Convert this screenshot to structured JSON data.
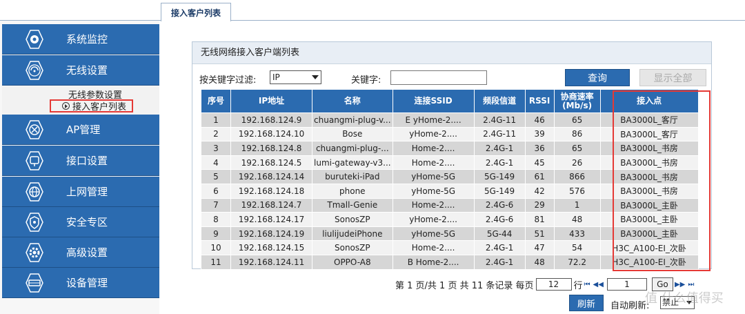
{
  "tab": {
    "label": "接入客户列表"
  },
  "sidebar": {
    "items": [
      {
        "label": "系统监控",
        "icon": "gear-monitor-icon"
      },
      {
        "label": "无线设置",
        "icon": "wifi-icon"
      },
      {
        "label": "AP管理",
        "icon": "ap-icon"
      },
      {
        "label": "接口设置",
        "icon": "port-icon"
      },
      {
        "label": "上网管理",
        "icon": "globe-icon"
      },
      {
        "label": "安全专区",
        "icon": "shield-icon"
      },
      {
        "label": "高级设置",
        "icon": "settings-icon"
      },
      {
        "label": "设备管理",
        "icon": "device-icon"
      }
    ],
    "submenu": {
      "item1": "无线参数设置",
      "item2": "接入客户列表"
    }
  },
  "panel": {
    "title": "无线网络接入客户端列表"
  },
  "filter": {
    "label": "按关键字过滤:",
    "selected": "IP",
    "keyword_label": "关键字:",
    "keyword_value": "",
    "query_button": "查询",
    "show_all_button": "显示全部"
  },
  "table": {
    "headers": [
      "序号",
      "IP地址",
      "名称",
      "连接SSID",
      "频段信道",
      "RSSI",
      "协商速率 (Mb/s)",
      "接入点"
    ],
    "rows": [
      [
        "1",
        "192.168.124.9",
        "chuangmi-plug-v...",
        "E    yHome-2....",
        "2.4G-11",
        "46",
        "65",
        "BA3000L_客厅"
      ],
      [
        "2",
        "192.168.124.10",
        "Bose",
        "    yHome-2....",
        "2.4G-11",
        "39",
        "86",
        "BA3000L_客厅"
      ],
      [
        "3",
        "192.168.124.8",
        "chuangmi-plug-...",
        "     Home-2....",
        "2.4G-1",
        "36",
        "65",
        "BA3000L_书房"
      ],
      [
        "4",
        "192.168.124.5",
        "lumi-gateway-v3...",
        "     Home-2....",
        "2.4G-1",
        "45",
        "26",
        "BA3000L_书房"
      ],
      [
        "5",
        "192.168.124.14",
        "buruteki-iPad",
        "     yHome-5G",
        "5G-149",
        "61",
        "866",
        "BA3000L_书房"
      ],
      [
        "6",
        "192.168.124.18",
        "phone",
        "     yHome-5G",
        "5G-149",
        "42",
        "576",
        "BA3000L_书房"
      ],
      [
        "7",
        "192.168.124.7",
        "Tmall-Genie",
        "     Home-2....",
        "2.4G-6",
        "29",
        "1",
        "BA3000L_主卧"
      ],
      [
        "8",
        "192.168.124.17",
        "SonosZP",
        "     yHome-2....",
        "2.4G-6",
        "81",
        "48",
        "BA3000L_主卧"
      ],
      [
        "9",
        "192.168.124.19",
        "liulijudeiPhone",
        "     yHome-5G",
        "5G-44",
        "51",
        "433",
        "BA3000L_主卧"
      ],
      [
        "10",
        "192.168.124.15",
        "SonosZP",
        "     Home-2....",
        "2.4G-1",
        "47",
        "54",
        "H3C_A100-EI_次卧"
      ],
      [
        "11",
        "192.168.124.11",
        "OPPO-A8",
        "B     Home-2....",
        "2.4G-1",
        "48",
        "72.2",
        "H3C_A100-EI_次卧"
      ]
    ]
  },
  "pager": {
    "summary": "第 1 页/共 1 页 共 11 条记录 每页",
    "per_page": "12",
    "row_label": "行",
    "page_value": "1",
    "go_label": "Go"
  },
  "footer": {
    "refresh_button": "刷新",
    "auto_label": "自动刷新:",
    "auto_value": "禁止"
  },
  "watermark": "值 什么值得买"
}
